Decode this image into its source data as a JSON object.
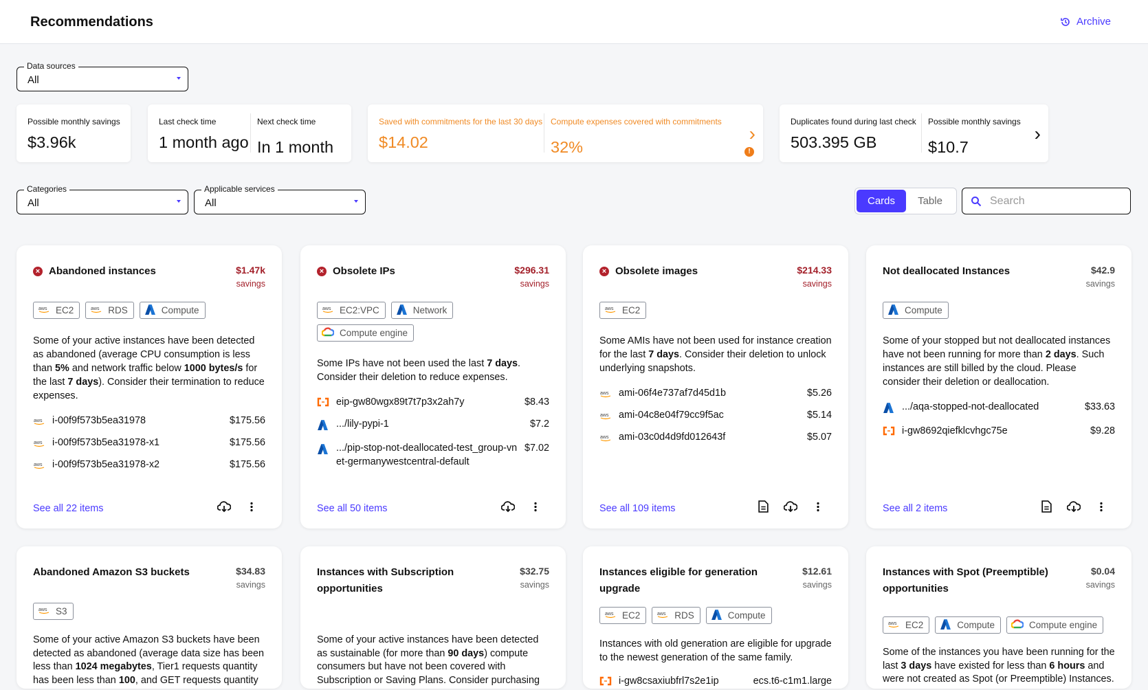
{
  "header": {
    "title": "Recommendations",
    "archive_label": "Archive"
  },
  "filters": {
    "data_sources": {
      "label": "Data sources",
      "value": "All"
    },
    "categories": {
      "label": "Categories",
      "value": "All"
    },
    "services": {
      "label": "Applicable services",
      "value": "All"
    }
  },
  "kpis": {
    "savings": {
      "label": "Possible monthly savings",
      "value": "$3.96k"
    },
    "last_check": {
      "label": "Last check time",
      "value": "1 month ago"
    },
    "next_check": {
      "label": "Next check time",
      "value": "In 1 month"
    },
    "commit_saved": {
      "label": "Saved with commitments for the last 30 days",
      "value": "$14.02"
    },
    "commit_cov": {
      "label": "Compute expenses covered with commitments",
      "value": "32%"
    },
    "dup": {
      "label": "Duplicates found during last check",
      "value": "503.395 GB"
    },
    "dup_savings": {
      "label": "Possible monthly savings",
      "value": "$10.7"
    }
  },
  "view": {
    "cards": "Cards",
    "table": "Table",
    "search_placeholder": "Search"
  },
  "colors": {
    "accent": "#4a3aff",
    "critical": "#a3202a",
    "warning": "#f08a24"
  },
  "cards": [
    {
      "title": "Abandoned instances",
      "critical": true,
      "amount": "$1.47k",
      "savings": "savings",
      "tags": [
        {
          "icon": "aws",
          "label": "EC2"
        },
        {
          "icon": "aws",
          "label": "RDS"
        },
        {
          "icon": "azure",
          "label": "Compute"
        }
      ],
      "desc": [
        {
          "t": "Some of your active instances have been detected as abandoned (average CPU consumption is less than "
        },
        {
          "t": "5%",
          "b": true
        },
        {
          "t": " and network traffic below "
        },
        {
          "t": "1000 bytes/s",
          "b": true
        },
        {
          "t": " for the last "
        },
        {
          "t": "7 days",
          "b": true
        },
        {
          "t": "). Consider their termination to reduce expenses."
        }
      ],
      "items": [
        {
          "icon": "aws",
          "name": "i-00f9f573b5ea31978",
          "value": "$175.56"
        },
        {
          "icon": "aws",
          "name": "i-00f9f573b5ea31978-x1",
          "value": "$175.56"
        },
        {
          "icon": "aws",
          "name": "i-00f9f573b5ea31978-x2",
          "value": "$175.56"
        }
      ],
      "see_all": "See all 22 items",
      "actions": [
        "download"
      ]
    },
    {
      "title": "Obsolete IPs",
      "critical": true,
      "amount": "$296.31",
      "savings": "savings",
      "tags": [
        {
          "icon": "aws",
          "label": "EC2:VPC"
        },
        {
          "icon": "azure",
          "label": "Network"
        },
        {
          "icon": "gcp",
          "label": "Compute engine"
        }
      ],
      "desc": [
        {
          "t": "Some IPs have not been used the last "
        },
        {
          "t": "7 days",
          "b": true
        },
        {
          "t": ". Consider their deletion to reduce expenses."
        }
      ],
      "items": [
        {
          "icon": "alibaba",
          "name": "eip-gw80wgx89t7t7p3x2ah7y",
          "value": "$8.43"
        },
        {
          "icon": "azure",
          "name": ".../lily-pypi-1",
          "value": "$7.2"
        },
        {
          "icon": "azure",
          "name": ".../pip-stop-not-deallocated-test_group-vnet-germanywestcentral-default",
          "value": "$7.02"
        }
      ],
      "see_all": "See all 50 items",
      "actions": [
        "download"
      ]
    },
    {
      "title": "Obsolete images",
      "critical": true,
      "amount": "$214.33",
      "savings": "savings",
      "tags": [
        {
          "icon": "aws",
          "label": "EC2"
        }
      ],
      "desc": [
        {
          "t": "Some AMIs have not been used for instance creation for the last "
        },
        {
          "t": "7 days",
          "b": true
        },
        {
          "t": ". Consider their deletion to unlock underlying snapshots."
        }
      ],
      "items": [
        {
          "icon": "aws",
          "name": "ami-06f4e737af7d45d1b",
          "value": "$5.26"
        },
        {
          "icon": "aws",
          "name": "ami-04c8e04f79cc9f5ac",
          "value": "$5.14"
        },
        {
          "icon": "aws",
          "name": "ami-03c0d4d9fd012643f",
          "value": "$5.07"
        }
      ],
      "see_all": "See all 109 items",
      "actions": [
        "document",
        "download"
      ]
    },
    {
      "title": "Not deallocated Instances",
      "critical": false,
      "amount": "$42.9",
      "savings": "savings",
      "tags": [
        {
          "icon": "azure",
          "label": "Compute"
        }
      ],
      "desc": [
        {
          "t": "Some of your stopped but not deallocated instances have not been running for more than "
        },
        {
          "t": "2 days",
          "b": true
        },
        {
          "t": ". Such instances are still billed by the cloud. Please consider their deletion or deallocation."
        }
      ],
      "items": [
        {
          "icon": "azure",
          "name": ".../aqa-stopped-not-deallocated",
          "value": "$33.63"
        },
        {
          "icon": "alibaba",
          "name": "i-gw8692qiefklcvhgc75e",
          "value": "$9.28"
        }
      ],
      "see_all": "See all 2 items",
      "actions": [
        "document",
        "download"
      ]
    },
    {
      "title": "Abandoned Amazon S3 buckets",
      "critical": false,
      "amount": "$34.83",
      "savings": "savings",
      "tags": [
        {
          "icon": "aws",
          "label": "S3"
        }
      ],
      "desc": [
        {
          "t": "Some of your active Amazon S3 buckets have been detected as abandoned (average data size has been less than "
        },
        {
          "t": "1024 megabytes",
          "b": true
        },
        {
          "t": ", Tier1 requests quantity has been less than "
        },
        {
          "t": "100",
          "b": true
        },
        {
          "t": ", and GET requests quantity"
        }
      ],
      "items": [],
      "see_all": "",
      "actions": []
    },
    {
      "title": "Instances with Subscription opportunities",
      "critical": false,
      "amount": "$32.75",
      "savings": "savings",
      "tags": [],
      "desc": [
        {
          "t": "Some of your active instances have been detected as sustainable (for more than "
        },
        {
          "t": "90 days",
          "b": true
        },
        {
          "t": ") compute consumers but have not been covered with Subscription or Saving Plans. Consider purchasing"
        }
      ],
      "items": [],
      "see_all": "",
      "actions": []
    },
    {
      "title": "Instances eligible for generation upgrade",
      "critical": false,
      "amount": "$12.61",
      "savings": "savings",
      "tags": [
        {
          "icon": "aws",
          "label": "EC2"
        },
        {
          "icon": "aws",
          "label": "RDS"
        },
        {
          "icon": "azure",
          "label": "Compute"
        }
      ],
      "desc": [
        {
          "t": "Instances with old generation are eligible for upgrade to the newest generation of the same family."
        }
      ],
      "items": [
        {
          "icon": "alibaba",
          "name": "i-gw8csaxiubfrl7s2e1ip",
          "value": "ecs.t6-c1m1.large"
        }
      ],
      "see_all": "",
      "actions": []
    },
    {
      "title": "Instances with Spot (Preemptible) opportunities",
      "critical": false,
      "amount": "$0.04",
      "savings": "savings",
      "tags": [
        {
          "icon": "aws",
          "label": "EC2"
        },
        {
          "icon": "azure",
          "label": "Compute"
        },
        {
          "icon": "gcp",
          "label": "Compute engine"
        }
      ],
      "desc": [
        {
          "t": "Some of the instances you have been running for the last "
        },
        {
          "t": "3 days",
          "b": true
        },
        {
          "t": " have existed for less than "
        },
        {
          "t": "6 hours",
          "b": true
        },
        {
          "t": " and were not created as Spot (or Preemptible) Instances."
        }
      ],
      "items": [],
      "see_all": "",
      "actions": []
    }
  ]
}
